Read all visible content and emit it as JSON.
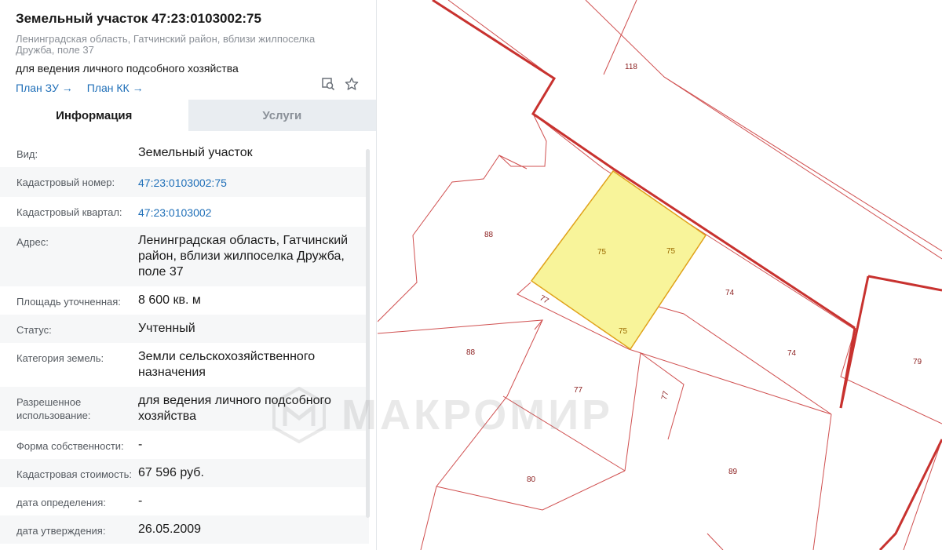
{
  "parcel": {
    "title": "Земельный участок 47:23:0103002:75",
    "address_short": "Ленинградская область, Гатчинский район, вблизи жилпоселка Дружба, поле 37",
    "purpose": "для ведения личного подсобного хозяйства",
    "links": {
      "plan_zu": "План ЗУ →",
      "plan_kk": "План КК →"
    }
  },
  "tabs": {
    "info": "Информация",
    "services": "Услуги"
  },
  "fields": [
    {
      "label": "Вид:",
      "value": "Земельный участок"
    },
    {
      "label": "Кадастровый номер:",
      "value": "47:23:0103002:75"
    },
    {
      "label": "Кадастровый квартал:",
      "value": "47:23:0103002"
    },
    {
      "label": "Адрес:",
      "value": "Ленинградская область, Гатчинский район, вблизи жилпоселка Дружба, поле 37"
    },
    {
      "label": "Площадь уточненная:",
      "value": "8 600 кв. м"
    },
    {
      "label": "Статус:",
      "value": "Учтенный"
    },
    {
      "label": "Категория земель:",
      "value": "Земли сельскохозяйственного назначения"
    },
    {
      "label": "Разрешенное использование:",
      "value": "для ведения личного подсобного хозяйства"
    },
    {
      "label": "Форма собственности:",
      "value": "-"
    },
    {
      "label": "Кадастровая стоимость:",
      "value": "67 596 руб."
    },
    {
      "label": "дата определения:",
      "value": "-"
    },
    {
      "label": "дата утверждения:",
      "value": "26.05.2009"
    }
  ],
  "map_labels": {
    "p118": "118",
    "p88a": "88",
    "p88b": "88",
    "p75a": "75",
    "p75b": "75",
    "p75c": "75",
    "p77a": "77",
    "p77b": "77",
    "p77c": "77",
    "p74a": "74",
    "p74b": "74",
    "p79": "79",
    "p80": "80",
    "p89": "89"
  },
  "watermark": "МАКРОМИР",
  "colors": {
    "parcel_border": "#d03a3a",
    "selected_fill": "#f8f49a",
    "selected_border": "#e0a21a",
    "link": "#1f6fb8"
  },
  "icons": {
    "map_search": "map-search-icon",
    "favorite": "star-icon"
  }
}
